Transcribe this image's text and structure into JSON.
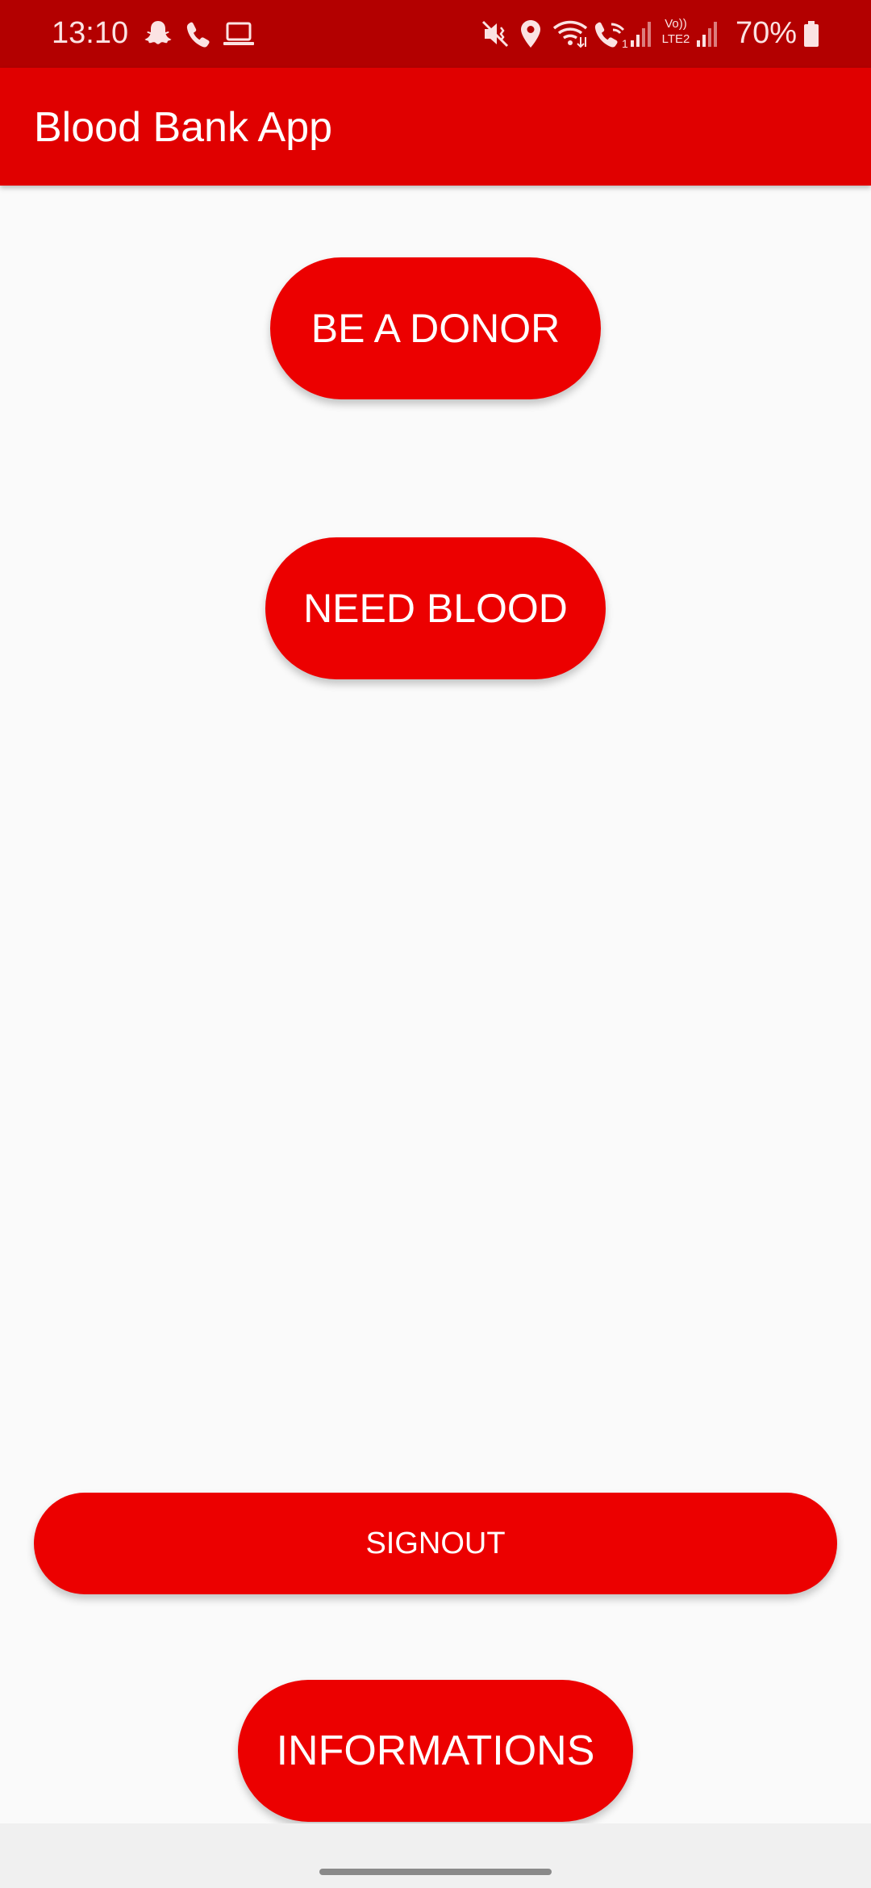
{
  "status_bar": {
    "time": "13:10",
    "battery_percent": "70%",
    "left_icons": [
      "snapchat-icon",
      "phone-icon",
      "laptop-icon"
    ],
    "right_icons": [
      "mute-vibrate-icon",
      "location-icon",
      "wifi-icon",
      "wifi-calling-icon",
      "signal-1-icon",
      "volte-lte2-icon",
      "signal-2-icon",
      "battery-icon"
    ],
    "volte_label_top": "Vo))",
    "volte_label_bottom": "LTE2"
  },
  "app_bar": {
    "title": "Blood Bank App"
  },
  "buttons": {
    "donor_label": "BE A DONOR",
    "need_blood_label": "NEED BLOOD",
    "signout_label": "SIGNOUT",
    "informations_label": "INFORMATIONS"
  },
  "colors": {
    "status_bar": "#b30000",
    "app_bar": "#e00000",
    "button": "#ec0000",
    "background": "#fafafa"
  }
}
